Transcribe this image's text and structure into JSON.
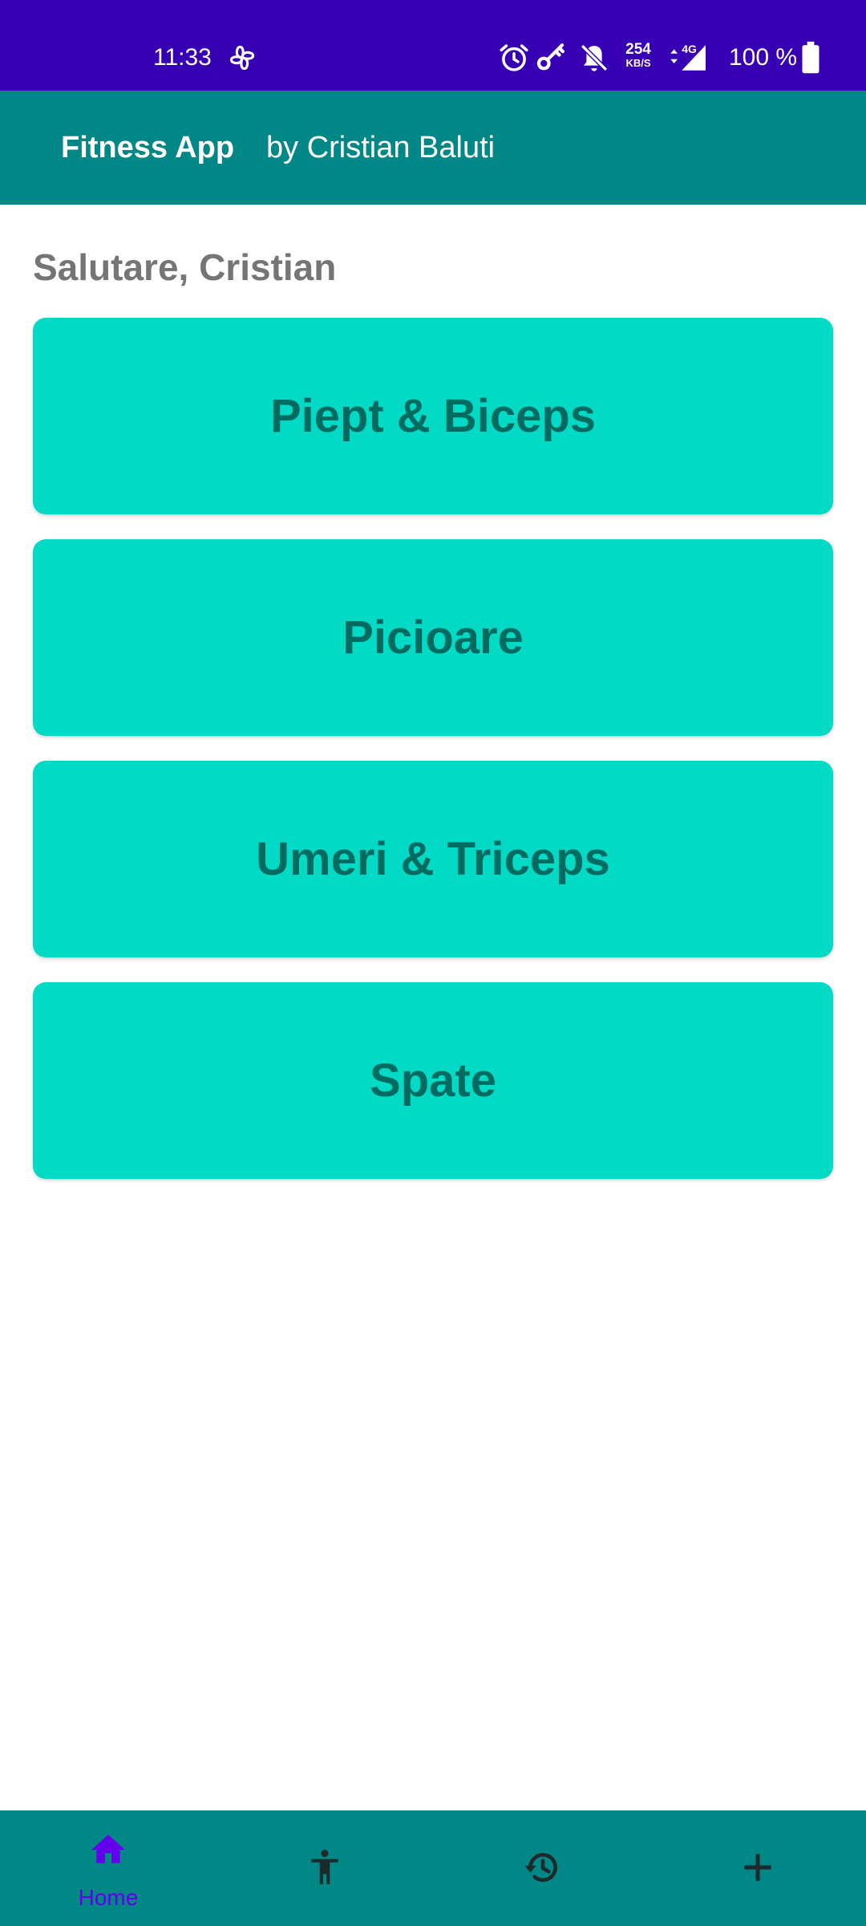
{
  "status_bar": {
    "time": "11:33",
    "network_speed_value": "254",
    "network_speed_unit": "KB/S",
    "network_type": "4G",
    "battery": "100 %",
    "background_color": "#3700b3",
    "icons": [
      "pinwheel-icon",
      "alarm-icon",
      "key-icon",
      "notifications-off-icon",
      "data-arrows-icon",
      "signal-icon",
      "battery-icon"
    ]
  },
  "app_bar": {
    "title": "Fitness App",
    "subtitle": "by Cristian Baluti",
    "background_color": "#018786"
  },
  "main": {
    "greeting": "Salutare, Cristian",
    "workouts": [
      {
        "label": "Piept & Biceps"
      },
      {
        "label": "Picioare"
      },
      {
        "label": "Umeri & Triceps"
      },
      {
        "label": "Spate"
      }
    ],
    "card_color": "#03dac5",
    "card_text_color": "#006c61"
  },
  "bottom_nav": {
    "background_color": "#018786",
    "active_color": "#6200ee",
    "inactive_color": "#1e2a2a",
    "items": [
      {
        "label": "Home",
        "icon": "home-icon",
        "active": true
      },
      {
        "label": "",
        "icon": "accessibility-icon",
        "active": false
      },
      {
        "label": "",
        "icon": "history-icon",
        "active": false
      },
      {
        "label": "",
        "icon": "add-icon",
        "active": false
      }
    ]
  }
}
